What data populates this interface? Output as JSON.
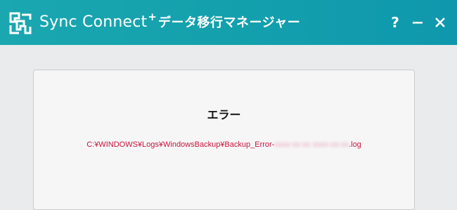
{
  "window": {
    "brand": "Sync Connect",
    "brand_suffix": "+",
    "subtitle": "データ移行マネージャー",
    "help_label": "?",
    "minimize_label": "–",
    "close_label": "✕"
  },
  "dialog": {
    "title": "エラー",
    "path_prefix": "C:¥WINDOWS¥Logs¥WindowsBackup¥Backup_Error-",
    "path_redacted": "xxxx-xx-xx xxxx-xx-xx",
    "path_suffix": ".log"
  },
  "colors": {
    "titlebar": "#14a1ad",
    "error_text": "#c8143c",
    "background": "#e9ebec"
  }
}
